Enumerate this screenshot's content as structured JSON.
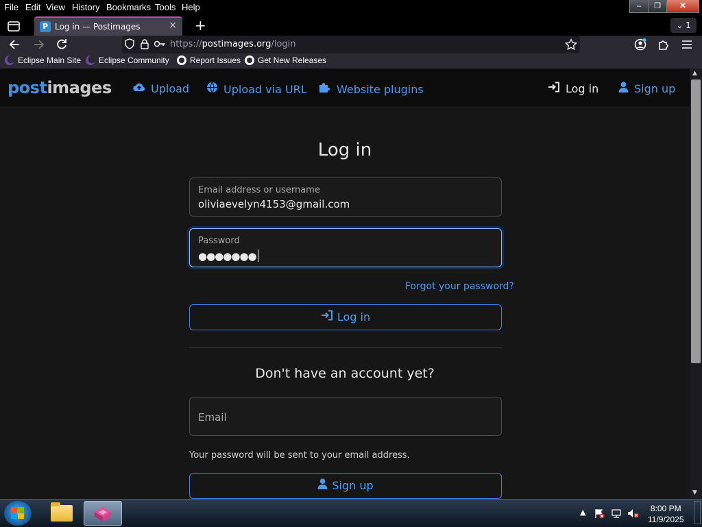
{
  "menubar": {
    "items": [
      {
        "label": "File"
      },
      {
        "label": "Edit"
      },
      {
        "label": "View"
      },
      {
        "label": "History"
      },
      {
        "label": "Bookmarks"
      },
      {
        "label": "Tools"
      },
      {
        "label": "Help"
      }
    ],
    "window_controls": {
      "minimize": "‒",
      "maximize": "❐",
      "close": "✕"
    }
  },
  "tabs": {
    "active": {
      "title": "Log in — Postimages",
      "favicon": "P"
    },
    "overflow_count": "1"
  },
  "navbar": {
    "url_prefix": "https://",
    "url_host": "postimages.org",
    "url_path": "/login"
  },
  "bookmarks": [
    {
      "label": "Eclipse Main Site",
      "icon": "eclipse-icon"
    },
    {
      "label": "Eclipse Community",
      "icon": "eclipse-icon"
    },
    {
      "label": "Report Issues",
      "icon": "github-icon"
    },
    {
      "label": "Get New Releases",
      "icon": "github-icon"
    }
  ],
  "site": {
    "logo_post": "post",
    "logo_images": "images",
    "nav": {
      "upload": "Upload",
      "upload_url": "Upload via URL",
      "plugins": "Website plugins",
      "login": "Log in",
      "signup": "Sign up"
    }
  },
  "login": {
    "title": "Log in",
    "email_label": "Email address or username",
    "email_value": "oliviaevelyn4153@gmail.com",
    "password_label": "Password",
    "password_mask": "●●●●●●●",
    "forgot": "Forgot your password?",
    "submit": "Log in"
  },
  "signup": {
    "title": "Don't have an account yet?",
    "email_placeholder": "Email",
    "hint": "Your password will be sent to your email address.",
    "submit": "Sign up"
  },
  "taskbar": {
    "time": "8:00 PM",
    "date": "11/9/2025"
  },
  "colors": {
    "accent": "#4c9bf0",
    "page_bg": "#161616",
    "nav_bg": "#0c0c0c"
  }
}
